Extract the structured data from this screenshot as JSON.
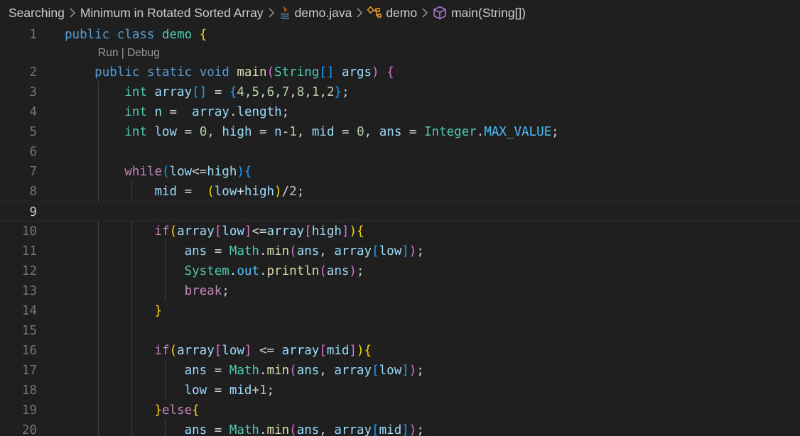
{
  "breadcrumb": {
    "items": [
      {
        "label": "Searching",
        "icon": ""
      },
      {
        "label": "Minimum in Rotated Sorted Array",
        "icon": ""
      },
      {
        "label": "demo.java",
        "icon": "java-file-icon"
      },
      {
        "label": "demo",
        "icon": "class-icon"
      },
      {
        "label": "main(String[])",
        "icon": "method-cube-icon"
      }
    ],
    "separator_icon": "chevron-right-icon"
  },
  "editor": {
    "language": "java",
    "current_line": 9,
    "codelens": {
      "run": "Run",
      "separator": "|",
      "debug": "Debug"
    },
    "line_numbers": [
      "1",
      "2",
      "3",
      "4",
      "5",
      "6",
      "7",
      "8",
      "9",
      "10",
      "11",
      "12",
      "13",
      "14",
      "15",
      "16",
      "17",
      "18",
      "19",
      "20"
    ],
    "lines": [
      "public class demo {",
      "    public static void main(String[] args) {",
      "        int array[] = {4,5,6,7,8,1,2};",
      "        int n =  array.length;",
      "        int low = 0, high = n-1, mid = 0, ans = Integer.MAX_VALUE;",
      "",
      "        while(low<=high){",
      "            mid =  (low+high)/2;",
      "",
      "            if(array[low]<=array[high]){",
      "                ans = Math.min(ans, array[low]);",
      "                System.out.println(ans);",
      "                break;",
      "            }",
      "",
      "            if(array[low] <= array[mid]){",
      "                ans = Math.min(ans, array[low]);",
      "                low = mid+1;",
      "            }else{",
      "                ans = Math.min(ans, array[mid]);"
    ]
  },
  "colors": {
    "background": "#1f1f1f",
    "line_number": "#6e7681",
    "keyword": "#569cd6",
    "control": "#c586c0",
    "type": "#4ec9b0",
    "function": "#dcdcaa",
    "variable": "#9cdcfe",
    "number": "#b5cea8",
    "constant": "#4fc1ff",
    "bracket_1": "#ffd700",
    "bracket_2": "#da70d6",
    "bracket_3": "#179fff",
    "java_icon": "#e76f00",
    "class_icon": "#ee9d28",
    "method_icon": "#b180d7"
  }
}
